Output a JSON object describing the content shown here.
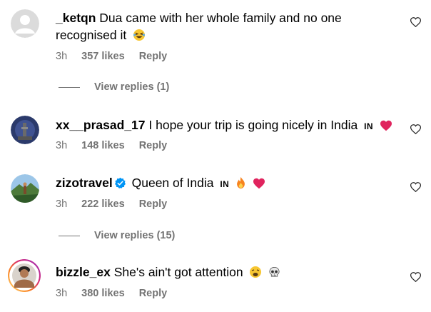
{
  "comments": [
    {
      "username": "_ketqn",
      "text": "Dua came with her whole family and no one recognised it",
      "time": "3h",
      "likes": "357 likes",
      "reply": "Reply",
      "view_replies": "View replies (1)"
    },
    {
      "username": "xx__prasad_17",
      "text": "I hope your trip is going nicely in India",
      "flag": "IN",
      "time": "3h",
      "likes": "148 likes",
      "reply": "Reply"
    },
    {
      "username": "zizotravel",
      "text": "Queen of India",
      "flag": "IN",
      "time": "3h",
      "likes": "222 likes",
      "reply": "Reply",
      "view_replies": "View replies (15)"
    },
    {
      "username": "bizzle_ex",
      "text": "She's ain't got attention",
      "time": "3h",
      "likes": "380 likes",
      "reply": "Reply"
    }
  ],
  "icons": {
    "like": "heart-outline-icon",
    "verified": "verified-badge-icon"
  },
  "colors": {
    "verified_blue": "#0095f6",
    "meta_gray": "#737373",
    "red_heart": "#e0245e"
  }
}
